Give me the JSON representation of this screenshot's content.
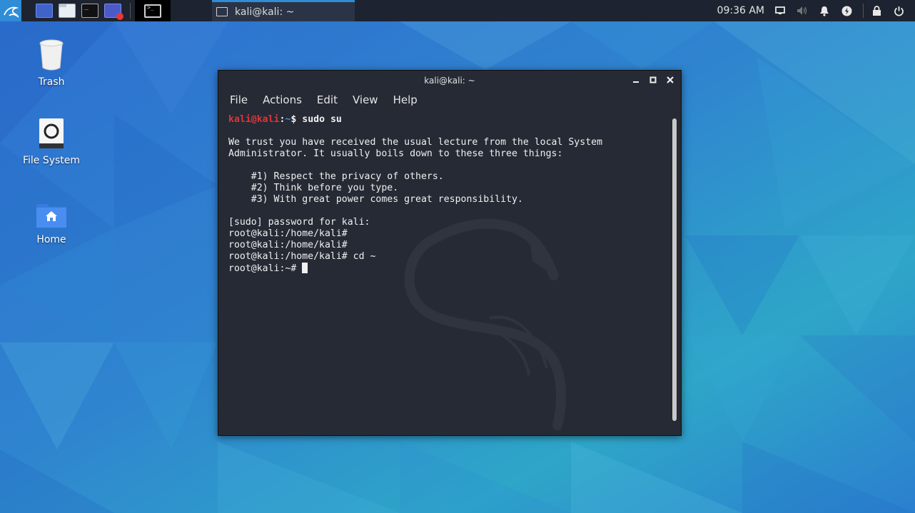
{
  "panel": {
    "launchers": [
      "show-desktop",
      "file-manager",
      "terminal-emulator",
      "screen-recorder"
    ],
    "taskbar_title": "kali@kali: ~",
    "clock": "09:36 AM",
    "tray_icons": [
      "display-icon",
      "volume-icon",
      "notifications-icon",
      "power-manager-icon",
      "lock-icon",
      "power-icon"
    ]
  },
  "desktop": {
    "icons": [
      {
        "label": "Trash",
        "icon": "trash-icon"
      },
      {
        "label": "File System",
        "icon": "drive-icon"
      },
      {
        "label": "Home",
        "icon": "home-folder-icon"
      }
    ]
  },
  "terminal": {
    "title": "kali@kali: ~",
    "menu": [
      "File",
      "Actions",
      "Edit",
      "View",
      "Help"
    ],
    "prompt_user": "kali@kali",
    "prompt_sep": ":",
    "prompt_path": "~",
    "prompt_end": "$ ",
    "command": "sudo su",
    "lecture": [
      "We trust you have received the usual lecture from the local System",
      "Administrator. It usually boils down to these three things:",
      "",
      "    #1) Respect the privacy of others.",
      "    #2) Think before you type.",
      "    #3) With great power comes great responsibility.",
      "",
      "[sudo] password for kali:",
      "root@kali:/home/kali#",
      "root@kali:/home/kali#",
      "root@kali:/home/kali# cd ~"
    ],
    "last_prompt": "root@kali:~# "
  },
  "colors": {
    "panel_bg": "#1d2330",
    "accent": "#2f8cd6",
    "terminal_bg": "#252a34",
    "prompt_user": "#e0343a",
    "prompt_path": "#3b8eea"
  }
}
